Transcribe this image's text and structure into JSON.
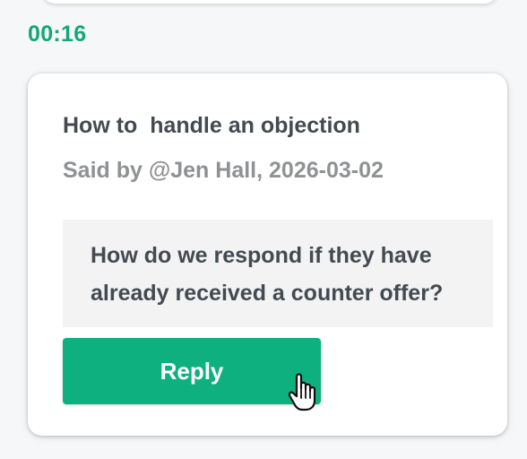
{
  "timestamp": "00:16",
  "comment": {
    "title": "How to  handle an objection",
    "meta": "Said by @Jen Hall, 2026-03-02",
    "quote": "How do we respond if they have already received a counter offer?",
    "reply_label": "Reply"
  },
  "colors": {
    "accent": "#0fb07f",
    "timestamp": "#13a874",
    "text": "#444a52",
    "meta": "#8f9193",
    "quote_bg": "#f3f3f3",
    "page_bg": "#f6f7f9"
  },
  "icons": {
    "cursor": "hand-pointer-icon"
  }
}
